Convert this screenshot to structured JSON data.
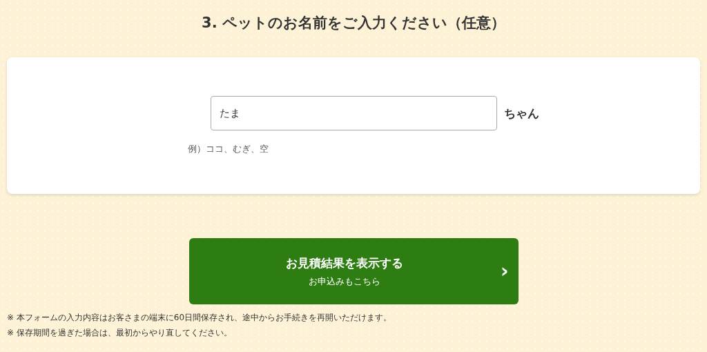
{
  "heading": "3. ペットのお名前をご入力ください（任意）",
  "name_field": {
    "value": "たま",
    "suffix": "ちゃん",
    "hint": "例）ココ、むぎ、空"
  },
  "submit_button": {
    "label": "お見積結果を表示する",
    "sublabel": "お申込みもこちら",
    "arrow": "›"
  },
  "notes": [
    "※ 本フォームの入力内容はお客さまの端末に60日間保存され、途中からお手続きを再開いただけます。",
    "※ 保存期間を過ぎた場合は、最初からやり直してください。"
  ]
}
